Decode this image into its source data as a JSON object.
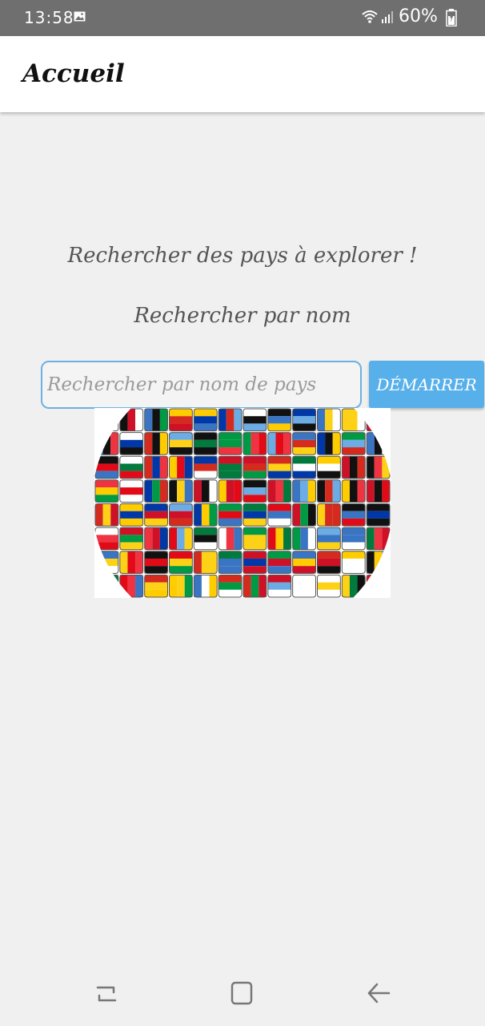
{
  "status_bar": {
    "time": "13:58",
    "battery": "60%",
    "icons": [
      "image-icon",
      "wifi-icon",
      "signal-icon",
      "battery-icon"
    ]
  },
  "app_bar": {
    "title": "Accueil"
  },
  "main": {
    "headline": "Rechercher des pays à explorer !",
    "subheadline": "Rechercher par nom",
    "search": {
      "placeholder": "Rechercher par nom de pays",
      "value": ""
    },
    "start_button": "DÉMARRER",
    "image_icon": "flags-globe-image"
  },
  "nav_bar": {
    "icons": [
      "recent-apps-icon",
      "home-icon",
      "back-icon"
    ]
  },
  "colors": {
    "status_bar": "#6f6f6f",
    "background": "#f0f0f0",
    "app_bar": "#ffffff",
    "accent": "#58b0ea",
    "input_border": "#6fb0e0",
    "text": "#555555"
  }
}
